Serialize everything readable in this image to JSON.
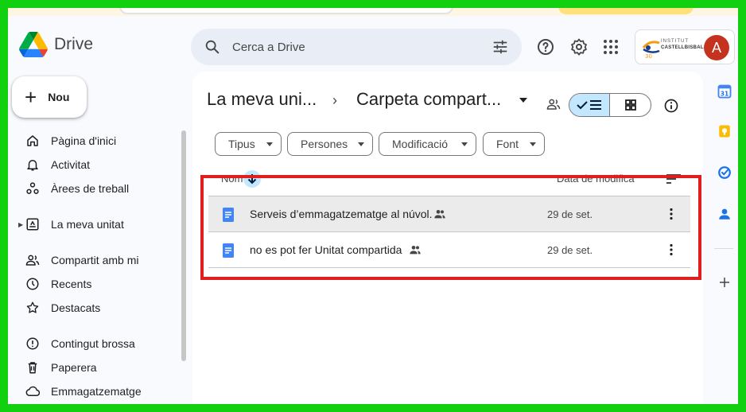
{
  "app": {
    "brand": "Drive"
  },
  "search": {
    "placeholder": "Cerca a Drive"
  },
  "account": {
    "initial": "A",
    "institution_line1": "INSTITUT",
    "institution_line2": "CASTELLBISBAL"
  },
  "new_button": {
    "label": "Nou"
  },
  "sidebar": {
    "items": [
      {
        "label": "Pàgina d'inici",
        "icon": "home-icon"
      },
      {
        "label": "Activitat",
        "icon": "bell-icon"
      },
      {
        "label": "Àrees de treball",
        "icon": "workspaces-icon"
      },
      {
        "label": "La meva unitat",
        "icon": "my-drive-icon"
      },
      {
        "label": "Compartit amb mi",
        "icon": "shared-people-icon"
      },
      {
        "label": "Recents",
        "icon": "clock-icon"
      },
      {
        "label": "Destacats",
        "icon": "star-icon"
      },
      {
        "label": "Contingut brossa",
        "icon": "spam-icon"
      },
      {
        "label": "Paperera",
        "icon": "trash-icon"
      },
      {
        "label": "Emmagatzematge",
        "icon": "cloud-icon"
      }
    ]
  },
  "breadcrumb": {
    "parent": "La meva uni...",
    "separator": "›",
    "current": "Carpeta compart..."
  },
  "filters": [
    {
      "label": "Tipus"
    },
    {
      "label": "Persones"
    },
    {
      "label": "Modificació"
    },
    {
      "label": "Font"
    }
  ],
  "columns": {
    "name": "Nom",
    "modified": "Data de modifica"
  },
  "files": [
    {
      "name": "Serveis d’emmagatzematge al núvol.",
      "date": "29 de set.",
      "shared": true,
      "selected": true
    },
    {
      "name": "no es pot fer Unitat compartida",
      "date": "29 de set.",
      "shared": true,
      "selected": false
    }
  ],
  "colors": {
    "accent": "#c2e7ff",
    "highlight": "#e01e1e",
    "doc_blue": "#4285f4",
    "avatar": "#c5321d"
  }
}
